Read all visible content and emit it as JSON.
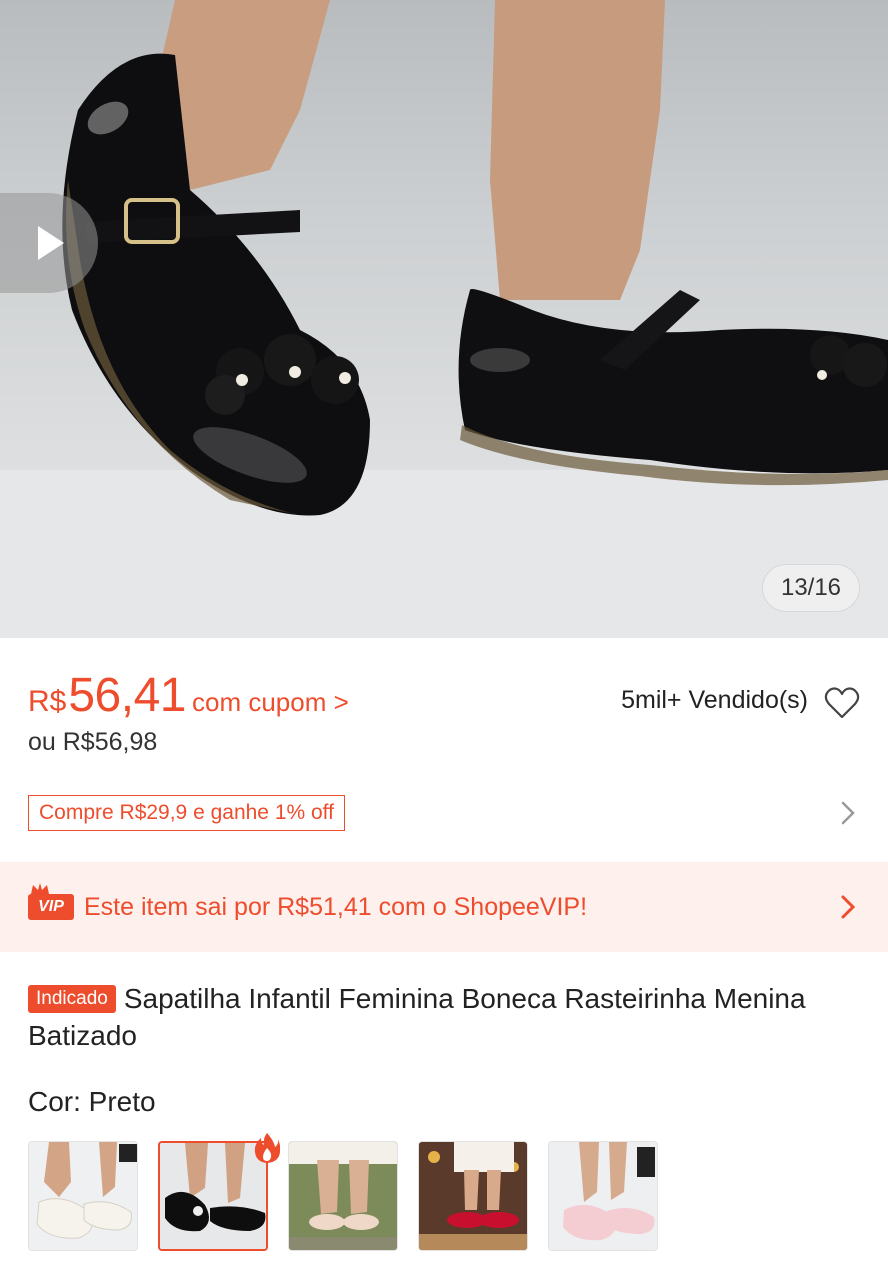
{
  "gallery": {
    "counter": "13/16",
    "play_icon": "play-icon"
  },
  "price": {
    "currency": "R$",
    "value": "56,41",
    "coupon_text": "com cupom >",
    "alt_price": "ou R$56,98",
    "sold": "5mil+ Vendido(s)",
    "promo": "Compre R$29,9 e ganhe 1% off"
  },
  "vip": {
    "badge": "VIP",
    "text": "Este item sai por R$51,41 com o ShopeeVIP!"
  },
  "product": {
    "badge": "Indicado",
    "title": "Sapatilha Infantil Feminina Boneca Rasteirinha Menina Batizado",
    "color_label": "Cor: Preto"
  },
  "variants": [
    {
      "name": "white",
      "selected": false
    },
    {
      "name": "black",
      "selected": true
    },
    {
      "name": "beige",
      "selected": false
    },
    {
      "name": "red",
      "selected": false
    },
    {
      "name": "pink",
      "selected": false
    }
  ],
  "colors": {
    "accent": "#ee4d2d",
    "vip_bg": "#fdf0ed"
  }
}
